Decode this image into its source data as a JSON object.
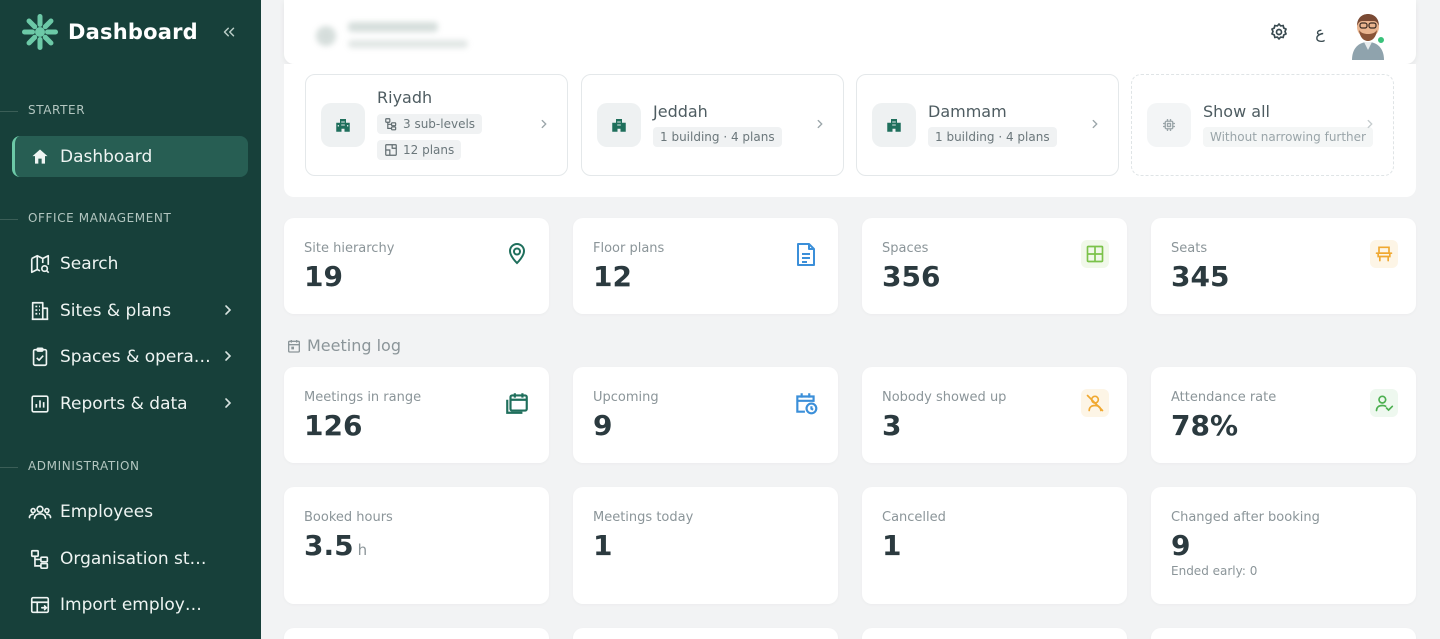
{
  "sidebar": {
    "brand": "Dashboard",
    "sections": [
      {
        "label": "STARTER"
      },
      {
        "label": "OFFICE MANAGEMENT"
      },
      {
        "label": "ADMINISTRATION"
      }
    ],
    "items": [
      {
        "label": "Dashboard",
        "icon": "home-icon"
      },
      {
        "label": "Search",
        "icon": "map-search-icon"
      },
      {
        "label": "Sites & plans",
        "icon": "building-icon"
      },
      {
        "label": "Spaces & operations",
        "icon": "clipboard-check-icon"
      },
      {
        "label": "Reports & data",
        "icon": "report-chart-icon"
      },
      {
        "label": "Employees",
        "icon": "users-icon"
      },
      {
        "label": "Organisation structure",
        "icon": "hierarchy-icon"
      },
      {
        "label": "Import employees",
        "icon": "import-table-icon"
      }
    ]
  },
  "topbar": {
    "language_label": "ع"
  },
  "sites": [
    {
      "name": "Riyadh",
      "pills": [
        "3 sub-levels",
        "12 plans"
      ]
    },
    {
      "name": "Jeddah",
      "pills": [
        "1 building · 4 plans"
      ]
    },
    {
      "name": "Dammam",
      "pills": [
        "1 building · 4 plans"
      ]
    },
    {
      "name": "Show all",
      "pills": [
        "Without narrowing further"
      ]
    }
  ],
  "stats_top": [
    {
      "label": "Site hierarchy",
      "value": "19",
      "icon": "map-pin-icon",
      "color": "#1f6f5c"
    },
    {
      "label": "Floor plans",
      "value": "12",
      "icon": "document-icon",
      "color": "#3b8fd9"
    },
    {
      "label": "Spaces",
      "value": "356",
      "icon": "layout-icon",
      "color": "#7bc24a"
    },
    {
      "label": "Seats",
      "value": "345",
      "icon": "seat-icon",
      "color": "#f0a830"
    }
  ],
  "meeting_log": {
    "title": "Meeting log"
  },
  "stats_meetings": [
    {
      "label": "Meetings in range",
      "value": "126",
      "icon": "calendar-stack-icon",
      "color": "#1f6f5c"
    },
    {
      "label": "Upcoming",
      "value": "9",
      "icon": "calendar-clock-icon",
      "color": "#3b8fd9"
    },
    {
      "label": "Nobody showed up",
      "value": "3",
      "icon": "user-off-icon",
      "color": "#f0a830"
    },
    {
      "label": "Attendance rate",
      "value": "78%",
      "icon": "user-check-icon",
      "color": "#4caf50"
    }
  ],
  "stats_bottom": [
    {
      "label": "Booked hours",
      "value": "3.5",
      "unit": "h"
    },
    {
      "label": "Meetings today",
      "value": "1"
    },
    {
      "label": "Cancelled",
      "value": "1"
    },
    {
      "label": "Changed after booking",
      "value": "9",
      "sub": "Ended early: 0"
    }
  ]
}
